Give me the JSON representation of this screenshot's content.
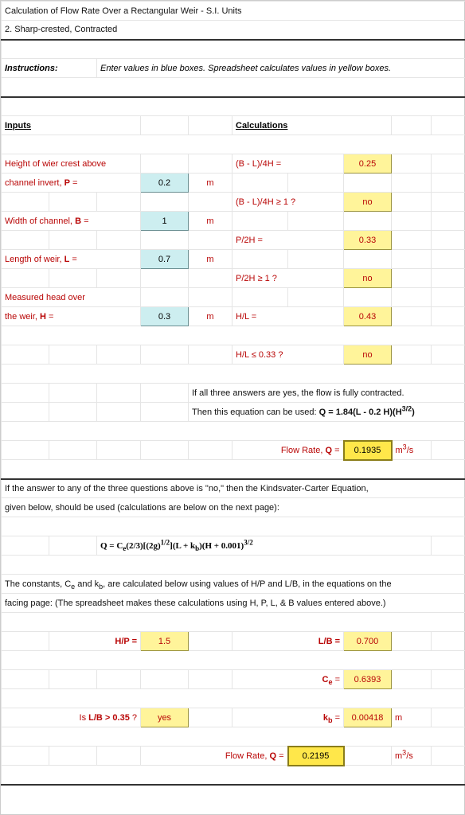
{
  "title": "Calculation of Flow Rate Over a Rectangular Weir - S.I. Units",
  "subtitle": "2.  Sharp-crested, Contracted",
  "instructions_label": "Instructions",
  "instructions_text": "Enter values in blue boxes.  Spreadsheet calculates values in yellow boxes.",
  "headers": {
    "inputs": "Inputs",
    "calculations": "Calculations"
  },
  "inputs": {
    "p_label1": "Height of wier crest above",
    "p_label2": "  channel invert, ",
    "p_symbol": "P",
    "p_value": "0.2",
    "p_unit": "m",
    "b_label": "Width of channel, ",
    "b_symbol": "B",
    "b_value": "1",
    "b_unit": "m",
    "l_label": "Length of weir, ",
    "l_symbol": "L",
    "l_value": "0.7",
    "l_unit": "m",
    "h_label1": "Measured head over",
    "h_label2": "  the weir, ",
    "h_symbol": "H",
    "h_value": "0.3",
    "h_unit": "m"
  },
  "calcs": {
    "c1_label": "(B - L)/4H =",
    "c1_value": "0.25",
    "c2_label": "(B - L)/4H  ≥ 1 ?",
    "c2_value": "no",
    "c3_label": "P/2H =",
    "c3_value": "0.33",
    "c4_label": "P/2H  ≥ 1 ?",
    "c4_value": "no",
    "c5_label": "H/L =",
    "c5_value": "0.43",
    "c6_label": "H/L  ≤  0.33 ?",
    "c6_value": "no"
  },
  "note1": "If all three answers are yes, the flow is fully contracted.",
  "note2_prefix": "Then this equation can be used:  ",
  "flowrate1_label": "Flow Rate, ",
  "flowrate1_symbol": "Q",
  "flowrate1_value": "0.1935",
  "flowrate1_unit_base": "m",
  "flowrate1_unit_suffix": "/s",
  "kc_note1": "If the answer to any of the three questions above is \"no,\" then the Kindsvater-Carter Equation,",
  "kc_note2": "given below, should be used  (calculations are below on the next page):",
  "constants_note1_prefix": "The constants, C",
  "constants_note1_mid": " and k",
  "constants_note1_suffix": ", are calculated below using values of H/P and L/B, in the equations on the",
  "constants_note2": "facing page:  (The spreadsheet makes these calculations using H, P, L, & B values entered above.)",
  "hp_label": "H/P  =",
  "hp_value": "1.5",
  "lb_label": "L/B  =",
  "lb_value": "0.700",
  "ce_label_base": "C",
  "ce_label_suffix": "  =",
  "ce_value": "0.6393",
  "lb_check_prefix": "Is ",
  "lb_check_mid": "L/B  >  0.35",
  "lb_check_suffix": " ?",
  "lb_check_value": "yes",
  "kb_label_base": "k",
  "kb_label_suffix": " =",
  "kb_value": "0.00418",
  "kb_unit": "m",
  "flowrate2_label": "Flow Rate, ",
  "flowrate2_symbol": "Q",
  "flowrate2_value": "0.2195",
  "flowrate2_unit_base": "m",
  "flowrate2_unit_suffix": "/s",
  "eq_sign": " = "
}
